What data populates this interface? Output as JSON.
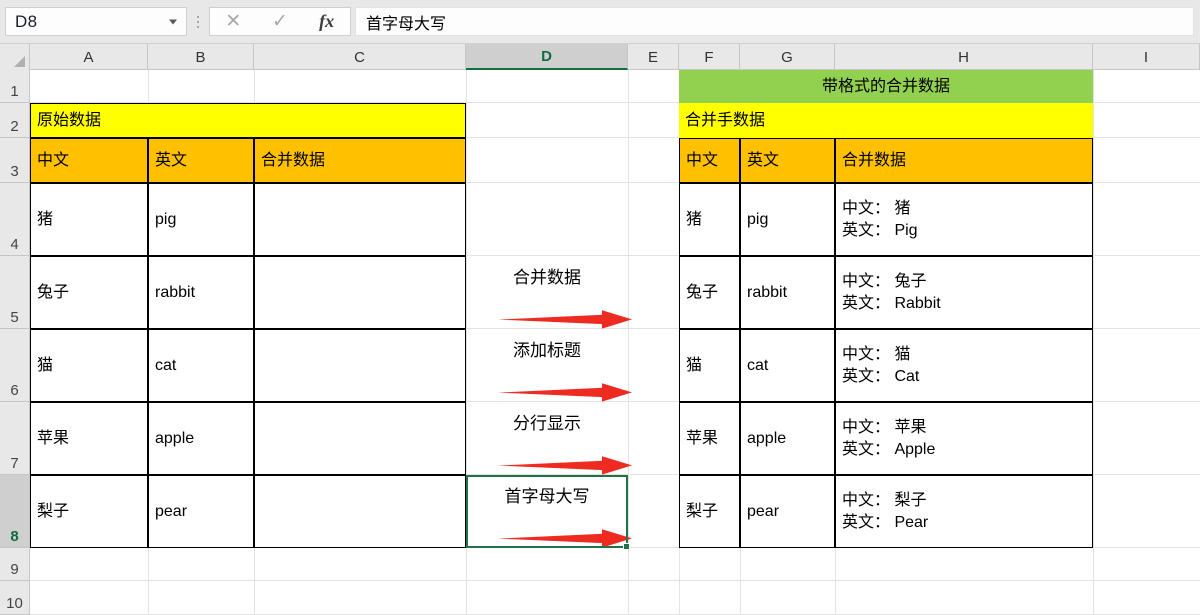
{
  "formula_bar": {
    "name_box_value": "D8",
    "cancel_icon": "✕",
    "enter_icon": "✓",
    "fx_icon": "fx",
    "formula_value": "首字母大写"
  },
  "grid": {
    "columns": [
      "A",
      "B",
      "C",
      "D",
      "E",
      "F",
      "G",
      "H",
      "I"
    ],
    "selected_column": "D",
    "rows": [
      "1",
      "2",
      "3",
      "4",
      "5",
      "6",
      "7",
      "8",
      "9",
      "10"
    ],
    "selected_row": "8",
    "selected_cell": "D8"
  },
  "left_table": {
    "banner": "原始数据",
    "headers": [
      "中文",
      "英文",
      "合并数据"
    ],
    "rows": [
      {
        "chinese": "猪",
        "english": "pig",
        "merged": ""
      },
      {
        "chinese": "兔子",
        "english": "rabbit",
        "merged": ""
      },
      {
        "chinese": "猫",
        "english": "cat",
        "merged": ""
      },
      {
        "chinese": "苹果",
        "english": "apple",
        "merged": ""
      },
      {
        "chinese": "梨子",
        "english": "pear",
        "merged": ""
      }
    ]
  },
  "right_table": {
    "title": "带格式的合并数据",
    "banner": "合并手数据",
    "headers": [
      "中文",
      "英文",
      "合并数据"
    ],
    "rows": [
      {
        "chinese": "猪",
        "english": "pig",
        "merged": "中文： 猪\n英文： Pig"
      },
      {
        "chinese": "兔子",
        "english": "rabbit",
        "merged": "中文： 兔子\n英文： Rabbit"
      },
      {
        "chinese": "猫",
        "english": "cat",
        "merged": "中文： 猫\n英文： Cat"
      },
      {
        "chinese": "苹果",
        "english": "apple",
        "merged": "中文： 苹果\n英文： Apple"
      },
      {
        "chinese": "梨子",
        "english": "pear",
        "merged": "中文： 梨子\n英文： Pear"
      }
    ]
  },
  "annotations": [
    {
      "label": "合并数据"
    },
    {
      "label": "添加标题"
    },
    {
      "label": "分行显示"
    },
    {
      "label": "首字母大写"
    }
  ],
  "colors": {
    "banner_yellow": "#FFFF00",
    "header_orange": "#FFC000",
    "title_green": "#92D050",
    "selection_green": "#217346",
    "arrow_red": "#EE2B20"
  }
}
